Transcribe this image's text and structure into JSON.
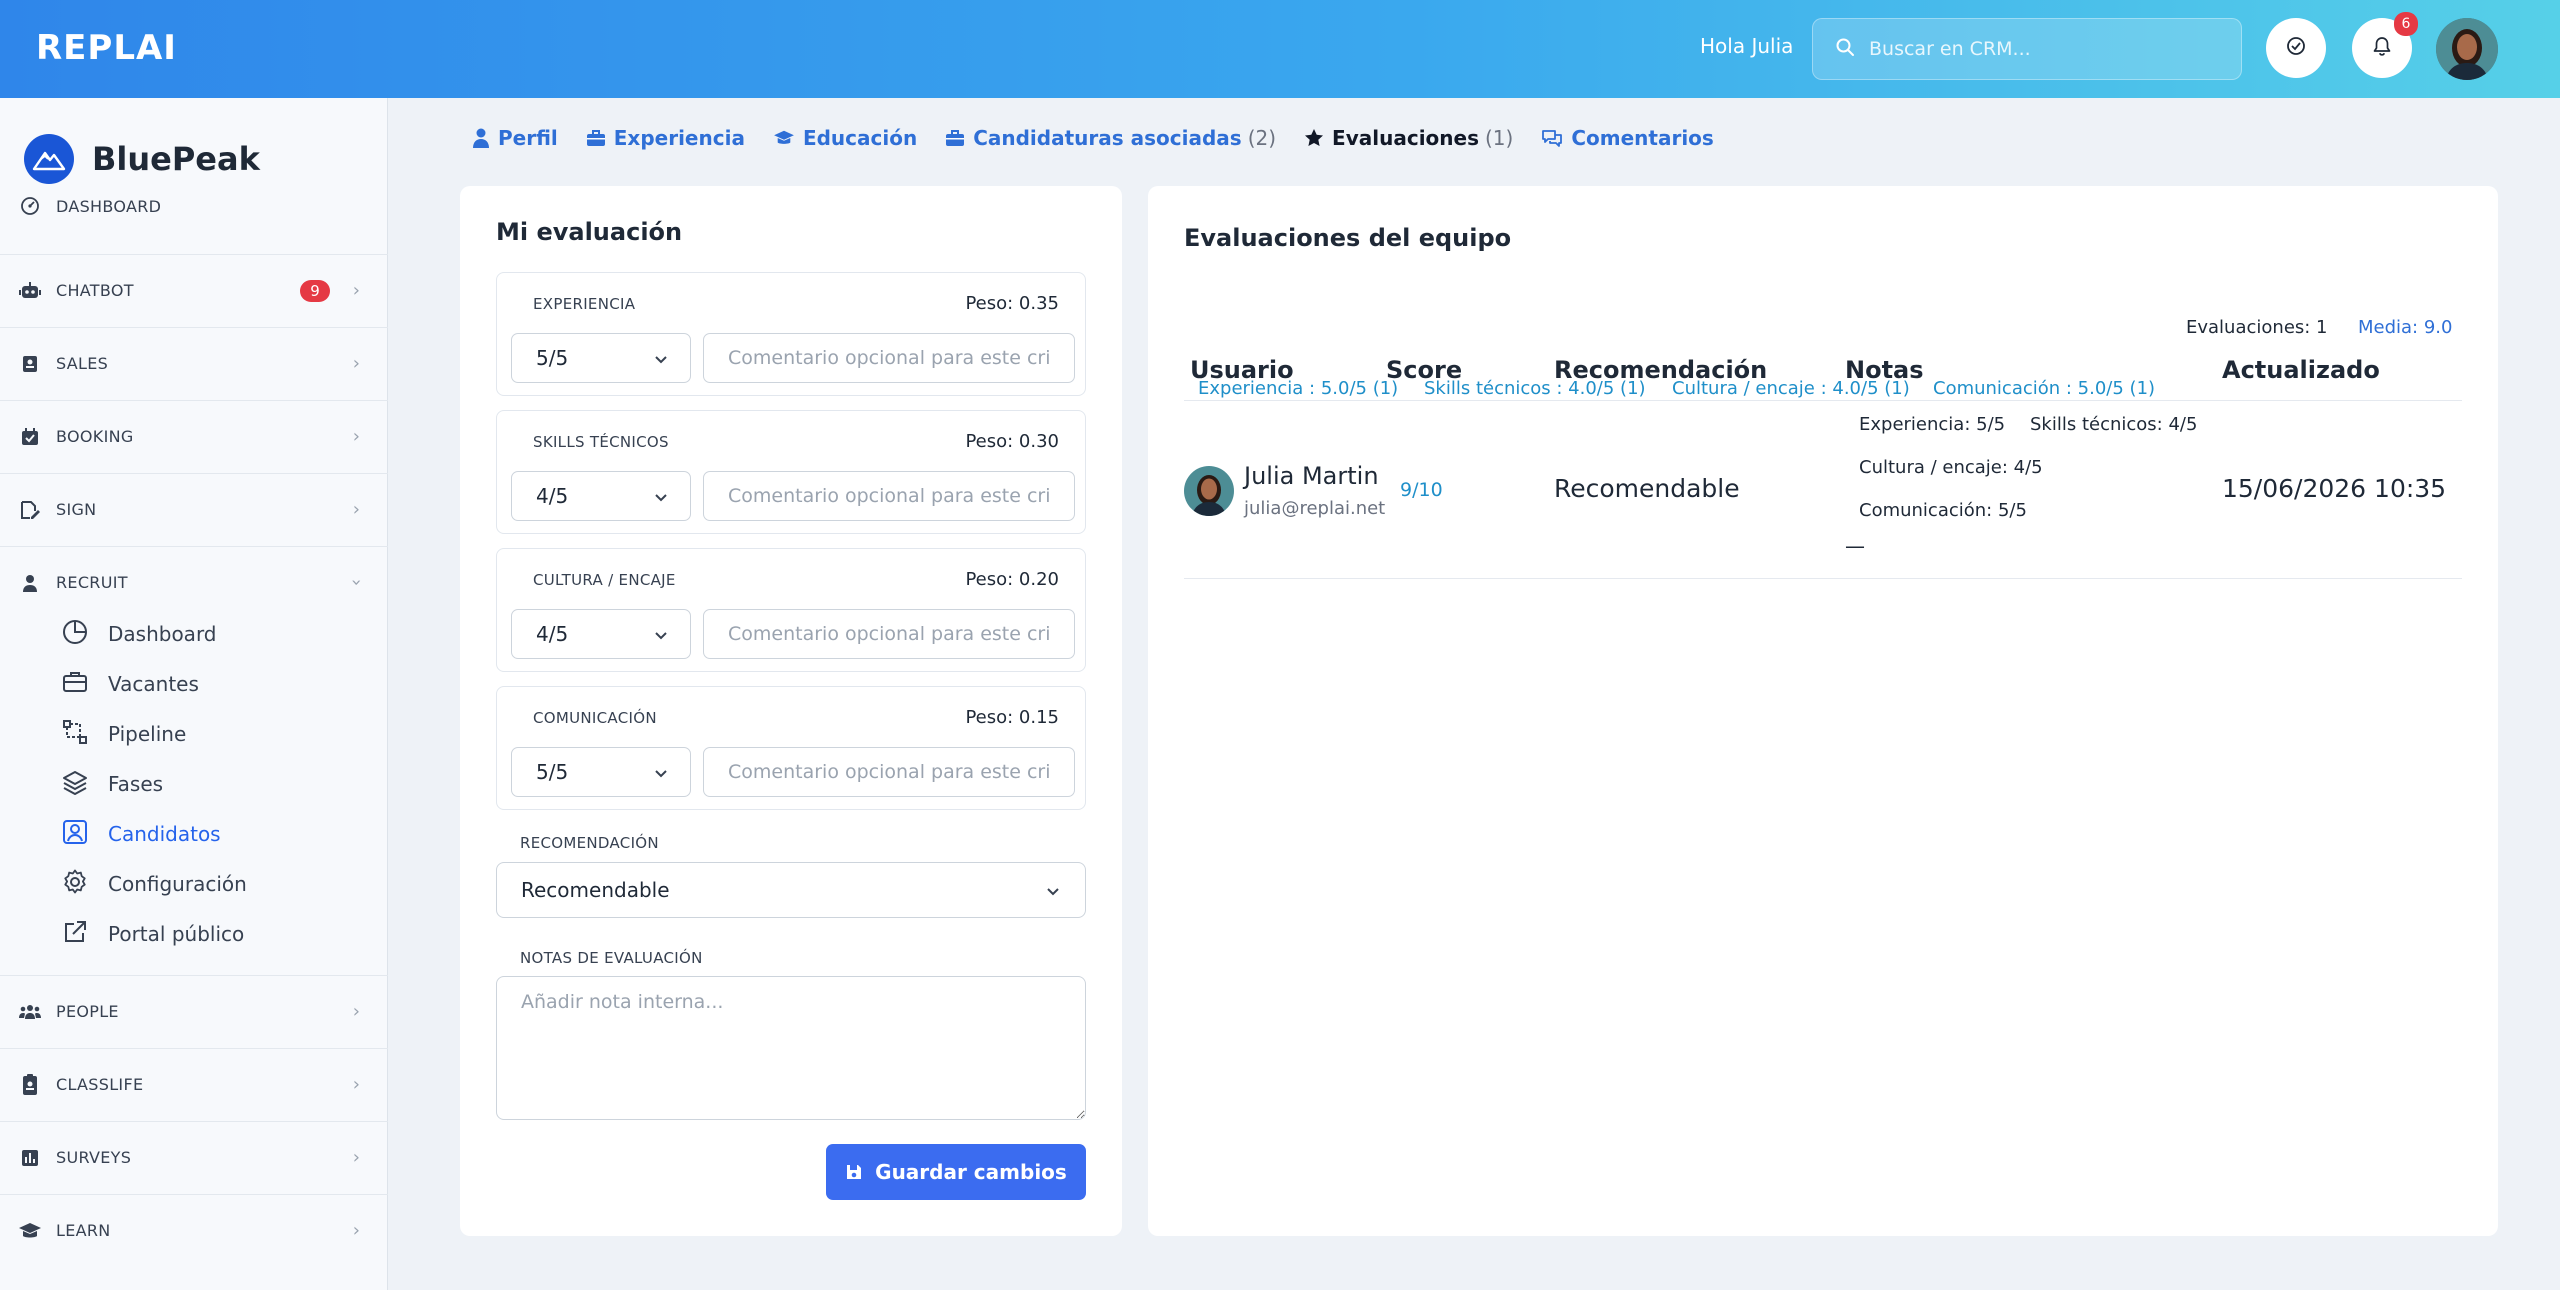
{
  "header": {
    "logo": "REPLAI",
    "greeting": "Hola Julia",
    "search_placeholder": "Buscar en CRM...",
    "notifications_count": "6"
  },
  "sidebar": {
    "brand": "BluePeak",
    "items": [
      {
        "label": "DASHBOARD",
        "icon": "dashboard-icon"
      },
      {
        "label": "CHATBOT",
        "icon": "robot-icon",
        "badge": "9"
      },
      {
        "label": "SALES",
        "icon": "contact-card-icon"
      },
      {
        "label": "BOOKING",
        "icon": "calendar-check-icon"
      },
      {
        "label": "SIGN",
        "icon": "signature-icon"
      },
      {
        "label": "RECRUIT",
        "icon": "user-tie-icon"
      },
      {
        "label": "PEOPLE",
        "icon": "people-icon"
      },
      {
        "label": "CLASSLIFE",
        "icon": "id-badge-icon"
      },
      {
        "label": "SURVEYS",
        "icon": "bar-chart-icon"
      },
      {
        "label": "LEARN",
        "icon": "graduation-cap-icon"
      }
    ],
    "recruit_sub": [
      {
        "label": "Dashboard",
        "icon": "pie-chart-icon"
      },
      {
        "label": "Vacantes",
        "icon": "briefcase-icon"
      },
      {
        "label": "Pipeline",
        "icon": "pipeline-icon"
      },
      {
        "label": "Fases",
        "icon": "layers-icon"
      },
      {
        "label": "Candidatos",
        "icon": "user-square-icon",
        "active": true
      },
      {
        "label": "Configuración",
        "icon": "gear-icon"
      },
      {
        "label": "Portal público",
        "icon": "external-link-icon"
      }
    ]
  },
  "tabs": [
    {
      "label": "Perfil",
      "icon": "user-icon"
    },
    {
      "label": "Experiencia",
      "icon": "briefcase-icon"
    },
    {
      "label": "Educación",
      "icon": "graduation-cap-icon"
    },
    {
      "label": "Candidaturas asociadas",
      "count": "(2)",
      "icon": "briefcase-icon"
    },
    {
      "label": "Evaluaciones",
      "count": "(1)",
      "icon": "star-icon",
      "active": true
    },
    {
      "label": "Comentarios",
      "icon": "comments-icon"
    }
  ],
  "my_eval": {
    "title": "Mi evaluación",
    "criteria": [
      {
        "name": "EXPERIENCIA",
        "weight": "Peso: 0.35",
        "score": "5/5",
        "comment_placeholder": "Comentario opcional para este criterio"
      },
      {
        "name": "SKILLS TÉCNICOS",
        "weight": "Peso: 0.30",
        "score": "4/5",
        "comment_placeholder": "Comentario opcional para este criterio"
      },
      {
        "name": "CULTURA / ENCAJE",
        "weight": "Peso: 0.20",
        "score": "4/5",
        "comment_placeholder": "Comentario opcional para este criterio"
      },
      {
        "name": "COMUNICACIÓN",
        "weight": "Peso: 0.15",
        "score": "5/5",
        "comment_placeholder": "Comentario opcional para este criterio"
      }
    ],
    "recommendation_label": "RECOMENDACIÓN",
    "recommendation_value": "Recomendable",
    "notes_label": "NOTAS DE EVALUACIÓN",
    "notes_placeholder": "Añadir nota interna...",
    "save_label": "Guardar cambios"
  },
  "team_eval": {
    "title": "Evaluaciones del equipo",
    "count_label": "Evaluaciones: 1",
    "avg_label": "Media: 9.0",
    "chips": [
      "Experiencia : 5.0/5 (1)",
      "Skills técnicos : 4.0/5 (1)",
      "Cultura / encaje : 4.0/5 (1)",
      "Comunicación : 5.0/5 (1)"
    ],
    "columns": [
      "Usuario",
      "Score",
      "Recomendación",
      "Notas",
      "Actualizado"
    ],
    "rows": [
      {
        "user_name": "Julia Martin",
        "user_email": "julia@replai.net",
        "score": "9/10",
        "recommendation": "Recomendable",
        "notes": [
          "Experiencia: 5/5",
          "Skills técnicos: 4/5",
          "Cultura / encaje: 4/5",
          "Comunicación: 5/5"
        ],
        "note_text": "—",
        "updated": "15/06/2026 10:35"
      }
    ]
  },
  "colors": {
    "accent": "#2563eb",
    "link": "#2f6fd6",
    "chip": "#1f8fc9",
    "badge": "#e53944",
    "button": "#3b6cf0"
  }
}
